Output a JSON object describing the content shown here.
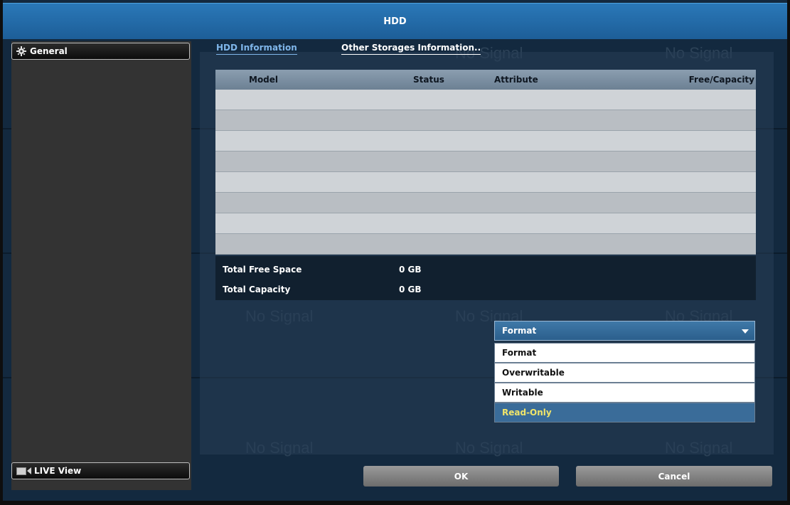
{
  "window": {
    "title": "HDD"
  },
  "sidebar": {
    "items": [
      {
        "label": "General",
        "icon": "gear-icon"
      },
      {
        "label": "LIVE View",
        "icon": "camera-icon"
      }
    ]
  },
  "background": {
    "watermark": "No Signal"
  },
  "tabs": [
    {
      "label": "HDD Information",
      "active": true
    },
    {
      "label": "Other Storages Information..",
      "active": false
    }
  ],
  "table": {
    "columns": [
      "Model",
      "Status",
      "Attribute",
      "Free/Capacity"
    ],
    "rows": []
  },
  "summary": {
    "free_label": "Total Free Space",
    "free_value": "0 GB",
    "capacity_label": "Total Capacity",
    "capacity_value": "0 GB"
  },
  "attribute_select": {
    "selected": "Format",
    "options": [
      "Format",
      "Overwritable",
      "Writable",
      "Read-Only"
    ],
    "highlighted": "Read-Only"
  },
  "buttons": {
    "ok": "OK",
    "cancel": "Cancel"
  },
  "colors": {
    "title_bar": "#1d5e98",
    "active_tab": "#7fb6ea",
    "highlight_text": "#f0e56a",
    "highlight_bg": "#3a6c99"
  }
}
